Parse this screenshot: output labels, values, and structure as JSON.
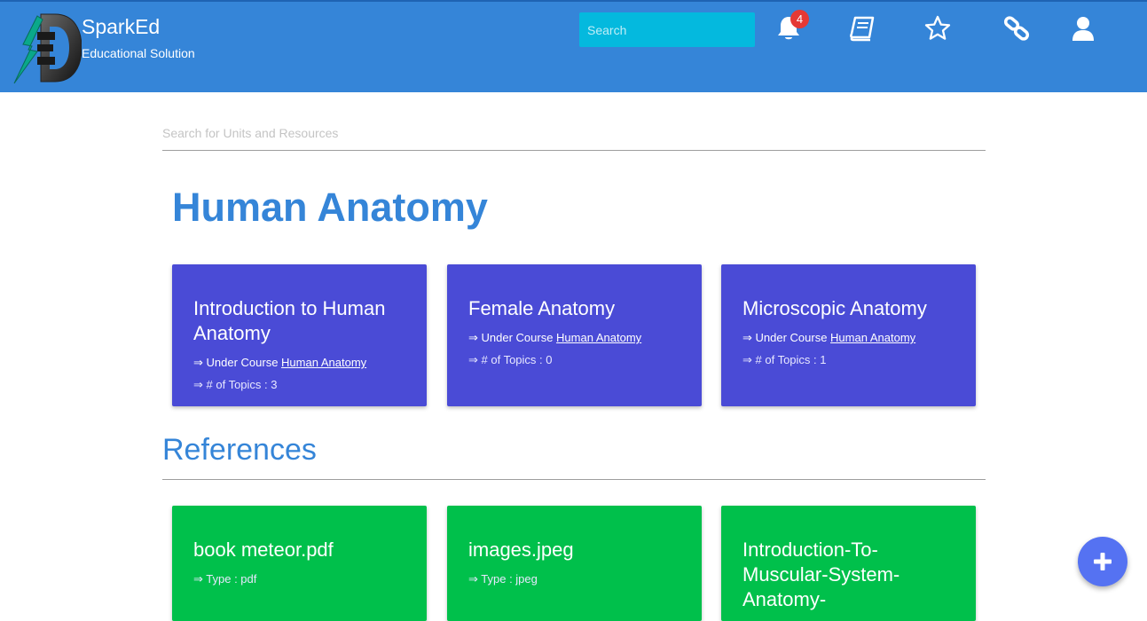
{
  "navbar": {
    "brand_title": "SparkEd",
    "brand_subtitle": "Educational Solution",
    "search_placeholder": "Search",
    "notification_count": "4",
    "icons": [
      "bell-icon",
      "book-icon",
      "star-icon",
      "link-icon",
      "user-icon"
    ]
  },
  "main": {
    "unit_search_placeholder": "Search for Units and Resources",
    "course_title": "Human Anatomy",
    "units": [
      {
        "title": "Introduction to Human Anatomy",
        "under_prefix": "⇒ Under Course ",
        "course_link": "Human Anatomy",
        "topics": "⇒ # of Topics : 3"
      },
      {
        "title": "Female Anatomy",
        "under_prefix": "⇒ Under Course ",
        "course_link": "Human Anatomy",
        "topics": "⇒ # of Topics : 0"
      },
      {
        "title": "Microscopic Anatomy",
        "under_prefix": "⇒ Under Course ",
        "course_link": "Human Anatomy",
        "topics": "⇒ # of Topics : 1"
      }
    ],
    "references_heading": "References",
    "references": [
      {
        "title": "book meteor.pdf",
        "type": "⇒ Type : pdf"
      },
      {
        "title": "images.jpeg",
        "type": "⇒ Type : jpeg"
      },
      {
        "title": "Introduction-To-Muscular-System-Anatomy-",
        "type": ""
      }
    ]
  },
  "colors": {
    "navbar": "#3585d8",
    "nav_search": "#04b9de",
    "unit_card": "#4a4bd6",
    "reference_card": "#00c04b",
    "fab": "#5572f2",
    "badge": "#e53935"
  }
}
